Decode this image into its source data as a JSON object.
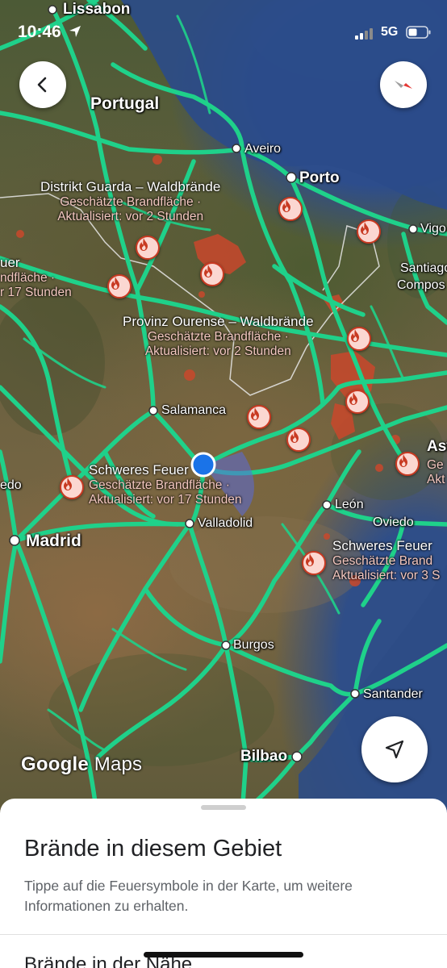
{
  "status_bar": {
    "time": "10:46",
    "network": "5G"
  },
  "map": {
    "attribution": {
      "google": "Google",
      "maps": "Maps"
    },
    "places": [
      {
        "name": "Lissabon"
      },
      {
        "name": "Portugal"
      },
      {
        "name": "Aveiro"
      },
      {
        "name": "Porto"
      },
      {
        "name": "Vigo"
      },
      {
        "name": "Santiago"
      },
      {
        "name": "Compos"
      },
      {
        "name": "Salamanca"
      },
      {
        "name": "Madrid"
      },
      {
        "name": "Valladolid"
      },
      {
        "name": "León"
      },
      {
        "name": "Oviedo"
      },
      {
        "name": "Burgos"
      },
      {
        "name": "Santander"
      },
      {
        "name": "Bilbao"
      },
      {
        "name": "Ast"
      },
      {
        "name": "edo"
      }
    ],
    "fires": [
      {
        "title": "Distrikt Guarda – Waldbrände",
        "line1": "Geschätzte Brandfläche ·",
        "line2": "Aktualisiert: vor 2 Stunden"
      },
      {
        "title": "Provinz Ourense – Waldbrände",
        "line1": "Geschätzte Brandfläche ·",
        "line2": "Aktualisiert: vor 2 Stunden"
      },
      {
        "title": "Schweres Feuer",
        "line1": "Geschätzte Brandfläche ·",
        "line2": "Aktualisiert: vor 17 Stunden"
      },
      {
        "title": "Schweres Feuer",
        "line1": "Geschätzte Brand",
        "line2": "Aktualisiert: vor 3 S"
      },
      {
        "title": "uer",
        "line1": "ndfläche ·",
        "line2": "r 17 Stunden"
      },
      {
        "title": "",
        "line1": "Ge",
        "line2": "Akt"
      }
    ]
  },
  "sheet": {
    "title": "Brände in diesem Gebiet",
    "description": "Tippe auf die Feuersymbole in der Karte, um weitere Informationen zu erhalten.",
    "nearby_heading": "Brände in der Nähe"
  },
  "colors": {
    "roads": "#1fd18a",
    "fire_pin_fill": "#fbd7d1",
    "fire_pin_stroke": "#c83a22",
    "burn_area": "#c9482c",
    "location_dot": "#1a73e8"
  },
  "icons": {
    "back": "chevron-left-icon",
    "compass": "compass-icon",
    "locate": "navigation-arrow-icon",
    "fire": "flame-icon"
  }
}
